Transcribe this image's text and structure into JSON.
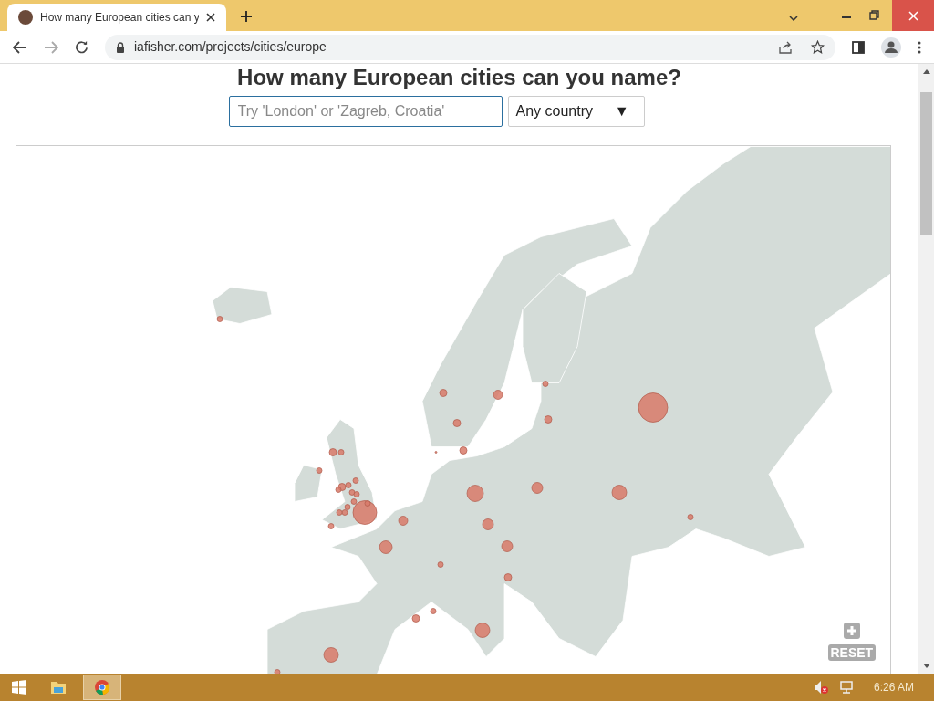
{
  "browser": {
    "tab_title": "How many European cities can y",
    "url": "iafisher.com/projects/cities/europe"
  },
  "page": {
    "heading": "How many European cities can you name?",
    "search": {
      "placeholder": "Try 'London' or 'Zagreb, Croatia'"
    },
    "country_select": {
      "value": "Any country",
      "arrow": "▼"
    }
  },
  "map": {
    "reset_label": "RESET"
  },
  "taskbar": {
    "time": "6:26 AM"
  }
}
